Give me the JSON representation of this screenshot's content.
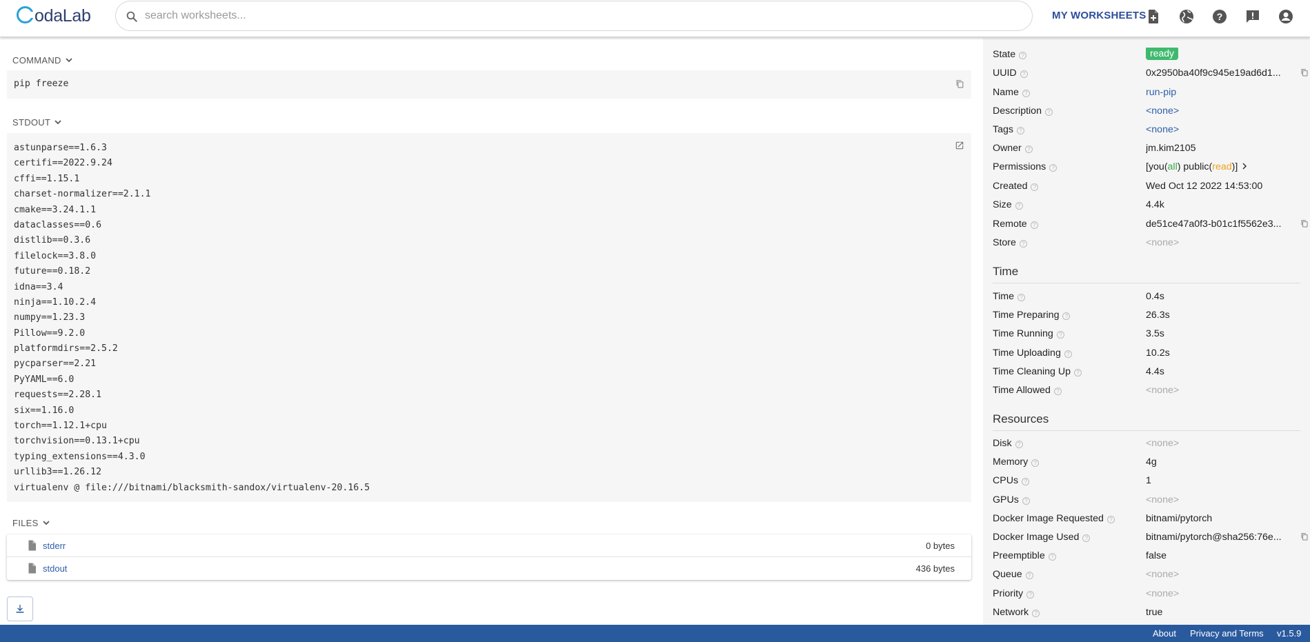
{
  "header": {
    "logo_text": "odaLab",
    "search_placeholder": "search worksheets...",
    "my_worksheets": "MY WORKSHEETS",
    "icons": [
      "new-worksheet-icon",
      "globe-icon",
      "help-icon",
      "feedback-icon",
      "account-icon"
    ]
  },
  "command": {
    "label": "COMMAND",
    "text": "pip freeze"
  },
  "stdout": {
    "label": "STDOUT",
    "lines": [
      "astunparse==1.6.3",
      "certifi==2022.9.24",
      "cffi==1.15.1",
      "charset-normalizer==2.1.1",
      "cmake==3.24.1.1",
      "dataclasses==0.6",
      "distlib==0.3.6",
      "filelock==3.8.0",
      "future==0.18.2",
      "idna==3.4",
      "ninja==1.10.2.4",
      "numpy==1.23.3",
      "Pillow==9.2.0",
      "platformdirs==2.5.2",
      "pycparser==2.21",
      "PyYAML==6.0",
      "requests==2.28.1",
      "six==1.16.0",
      "torch==1.12.1+cpu",
      "torchvision==0.13.1+cpu",
      "typing_extensions==4.3.0",
      "urllib3==1.26.12",
      "virtualenv @ file:///bitnami/blacksmith-sandox/virtualenv-20.16.5"
    ]
  },
  "files": {
    "label": "FILES",
    "items": [
      {
        "name": "stderr",
        "size": "0 bytes"
      },
      {
        "name": "stdout",
        "size": "436 bytes"
      }
    ]
  },
  "props": {
    "state_label": "State",
    "state_value": "ready",
    "uuid_label": "UUID",
    "uuid_value": "0x2950ba40f9c945e19ad6d1...",
    "name_label": "Name",
    "name_value": "run-pip",
    "description_label": "Description",
    "description_value": "<none>",
    "tags_label": "Tags",
    "tags_value": "<none>",
    "owner_label": "Owner",
    "owner_value": "jm.kim2105",
    "permissions_label": "Permissions",
    "perm_you": "[you(",
    "perm_all": "all",
    "perm_public": ") public(",
    "perm_read": "read",
    "perm_end": ")]",
    "created_label": "Created",
    "created_value": "Wed Oct 12 2022 14:53:00",
    "size_label": "Size",
    "size_value": "4.4k",
    "remote_label": "Remote",
    "remote_value": "de51ce47a0f3-b01c1f5562e3...",
    "store_label": "Store",
    "store_value": "<none>"
  },
  "time": {
    "heading": "Time",
    "rows": [
      {
        "label": "Time",
        "value": "0.4s",
        "none": false
      },
      {
        "label": "Time Preparing",
        "value": "26.3s",
        "none": false
      },
      {
        "label": "Time Running",
        "value": "3.5s",
        "none": false
      },
      {
        "label": "Time Uploading",
        "value": "10.2s",
        "none": false
      },
      {
        "label": "Time Cleaning Up",
        "value": "4.4s",
        "none": false
      },
      {
        "label": "Time Allowed",
        "value": "<none>",
        "none": true
      }
    ]
  },
  "resources": {
    "heading": "Resources",
    "rows": [
      {
        "label": "Disk",
        "value": "<none>",
        "none": true
      },
      {
        "label": "Memory",
        "value": "4g",
        "none": false
      },
      {
        "label": "CPUs",
        "value": "1",
        "none": false
      },
      {
        "label": "GPUs",
        "value": "<none>",
        "none": true
      },
      {
        "label": "Docker Image Requested",
        "value": "bitnami/pytorch",
        "none": false
      },
      {
        "label": "Docker Image Used",
        "value": "bitnami/pytorch@sha256:76e...",
        "none": false
      },
      {
        "label": "Preemptible",
        "value": "false",
        "none": false
      },
      {
        "label": "Queue",
        "value": "<none>",
        "none": true
      },
      {
        "label": "Priority",
        "value": "<none>",
        "none": true
      },
      {
        "label": "Network",
        "value": "true",
        "none": false
      }
    ]
  },
  "footer": {
    "about": "About",
    "privacy": "Privacy and Terms",
    "version": "v1.5.9"
  },
  "colors": {
    "accent": "#2e5fa8",
    "ready": "#3fb96e",
    "footer": "#2a5a9e"
  }
}
